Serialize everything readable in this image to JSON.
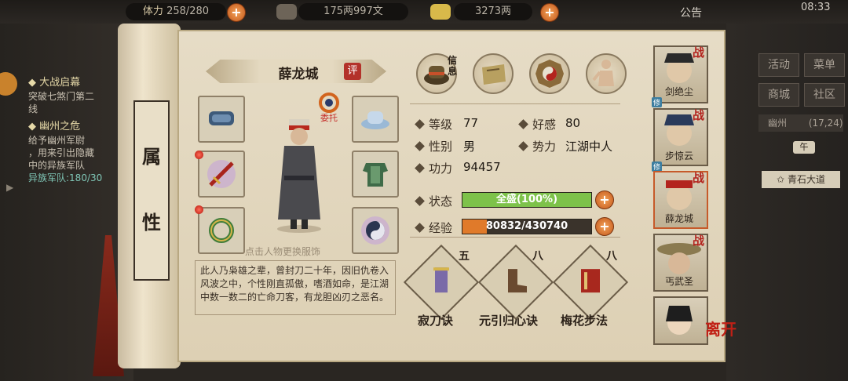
{
  "top": {
    "stamina_label": "体力",
    "stamina": "258/280",
    "copper": "175两997文",
    "silver": "3273两",
    "notice": "公告",
    "time": "08:33"
  },
  "quests": [
    {
      "title": "大战启幕",
      "desc": [
        "突破七煞门第二",
        "线"
      ]
    },
    {
      "title": "幽州之危",
      "desc": [
        "给予幽州军尉",
        "，用来引出隐藏",
        "中的异族军队"
      ],
      "progress": "异族军队:180/30"
    }
  ],
  "right_menu": {
    "buttons": [
      "活动",
      "菜单",
      "商城",
      "社区"
    ],
    "location": "幽州",
    "coords": "(17,24)",
    "time_of_day": "午",
    "area": "青石大道"
  },
  "scroll": {
    "attr_title": [
      "属",
      "性"
    ]
  },
  "character": {
    "name": "薛龙城",
    "rate_badge": "评",
    "entrust": "委托",
    "hint": "点击人物更换服饰",
    "bio": "此人乃枭雄之辈，曾封刀二十年，因旧仇卷入风波之中，个性刚直孤傲，嗜酒如命，是江湖中数一数二的亡命刀客，有龙胆凶刃之恶名。"
  },
  "tabs": [
    "信息",
    "物品",
    "八卦",
    "经脉"
  ],
  "tab_info_label": "信息",
  "stats": {
    "level_label": "等级",
    "level": "77",
    "favor_label": "好感",
    "favor": "80",
    "gender_label": "性别",
    "gender": "男",
    "faction_label": "势力",
    "faction": "江湖中人",
    "power_label": "功力",
    "power": "94457",
    "status_label": "状态",
    "status_value": "全盛(100%)",
    "status_pct": 100,
    "exp_label": "经验",
    "exp_value": "80832/430740",
    "exp_pct": 18.8
  },
  "skills": [
    {
      "name": "寂刀诀",
      "level": "五"
    },
    {
      "name": "元引归心诀",
      "level": "八"
    },
    {
      "name": "梅花步法",
      "level": "八"
    }
  ],
  "party": [
    {
      "name": "剑绝尘",
      "tag": "战",
      "train": "修"
    },
    {
      "name": "步惊云",
      "tag": "战",
      "train": "修"
    },
    {
      "name": "薛龙城",
      "tag": "战",
      "selected": true
    },
    {
      "name": "丐武圣",
      "tag": "战"
    },
    {
      "name": "",
      "tag": ""
    }
  ],
  "leave_label": "离开",
  "colors": {
    "status_bar": "#7dc24a",
    "exp_bar": "#e07a2a",
    "accent_red": "#b3241e"
  }
}
